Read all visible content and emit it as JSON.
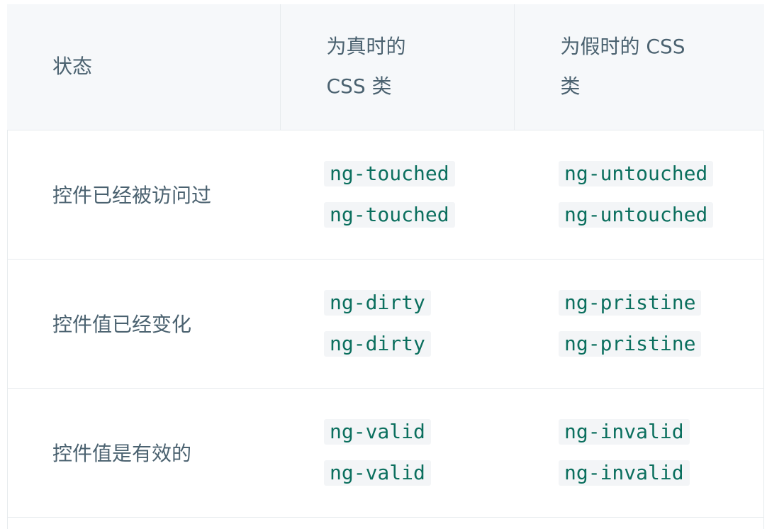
{
  "table": {
    "headers": [
      {
        "lines": [
          "状态"
        ]
      },
      {
        "lines": [
          "为真时的",
          "CSS 类"
        ]
      },
      {
        "lines": [
          "为假时的 CSS",
          "类"
        ]
      }
    ],
    "rows": [
      {
        "state": "控件已经被访问过",
        "true_class": [
          "ng-touched",
          "ng-touched"
        ],
        "false_class": [
          "ng-untouched",
          "ng-untouched"
        ]
      },
      {
        "state": "控件值已经变化",
        "true_class": [
          "ng-dirty",
          "ng-dirty"
        ],
        "false_class": [
          "ng-pristine",
          "ng-pristine"
        ]
      },
      {
        "state": "控件值是有效的",
        "true_class": [
          "ng-valid",
          "ng-valid"
        ],
        "false_class": [
          "ng-invalid",
          "ng-invalid"
        ]
      }
    ]
  },
  "colors": {
    "header_bg": "#f6f8fa",
    "text": "#4b6270",
    "code_text": "#0b6f5e",
    "code_bg": "#f3f5f7",
    "border": "#e7ebee"
  }
}
